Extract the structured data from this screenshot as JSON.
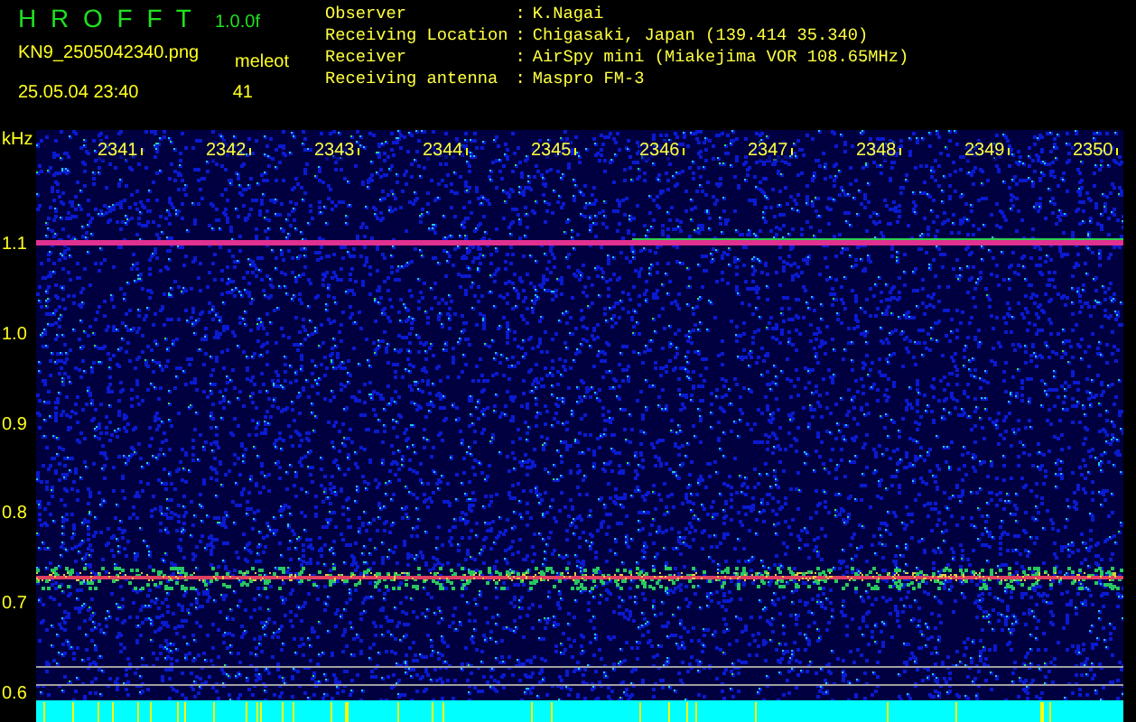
{
  "app": {
    "title": "H R O F F T",
    "version": "1.0.0f"
  },
  "file": "KN9_2505042340.png",
  "timestamp": "25.05.04 23:40",
  "detection": {
    "label": "meleot",
    "count": "41"
  },
  "info": [
    {
      "key": "Observer",
      "separator": ":",
      "value": "K.Nagai"
    },
    {
      "key": "Receiving Location",
      "separator": ":",
      "value": "Chigasaki, Japan (139.414 35.340)"
    },
    {
      "key": "Receiver",
      "separator": ":",
      "value": "AirSpy mini (Miakejima VOR 108.65MHz)"
    },
    {
      "key": "Receiving antenna",
      "separator": ":",
      "value": "Maspro FM-3"
    }
  ],
  "spectrogram": {
    "unit": "kHz",
    "time_labels": [
      "2341",
      "2342",
      "2343",
      "2344",
      "2345",
      "2346",
      "2347",
      "2348",
      "2349",
      "2350"
    ],
    "frequency_labels": [
      "1.1",
      "1.0",
      "0.9",
      "0.8",
      "0.7",
      "0.6"
    ]
  }
}
